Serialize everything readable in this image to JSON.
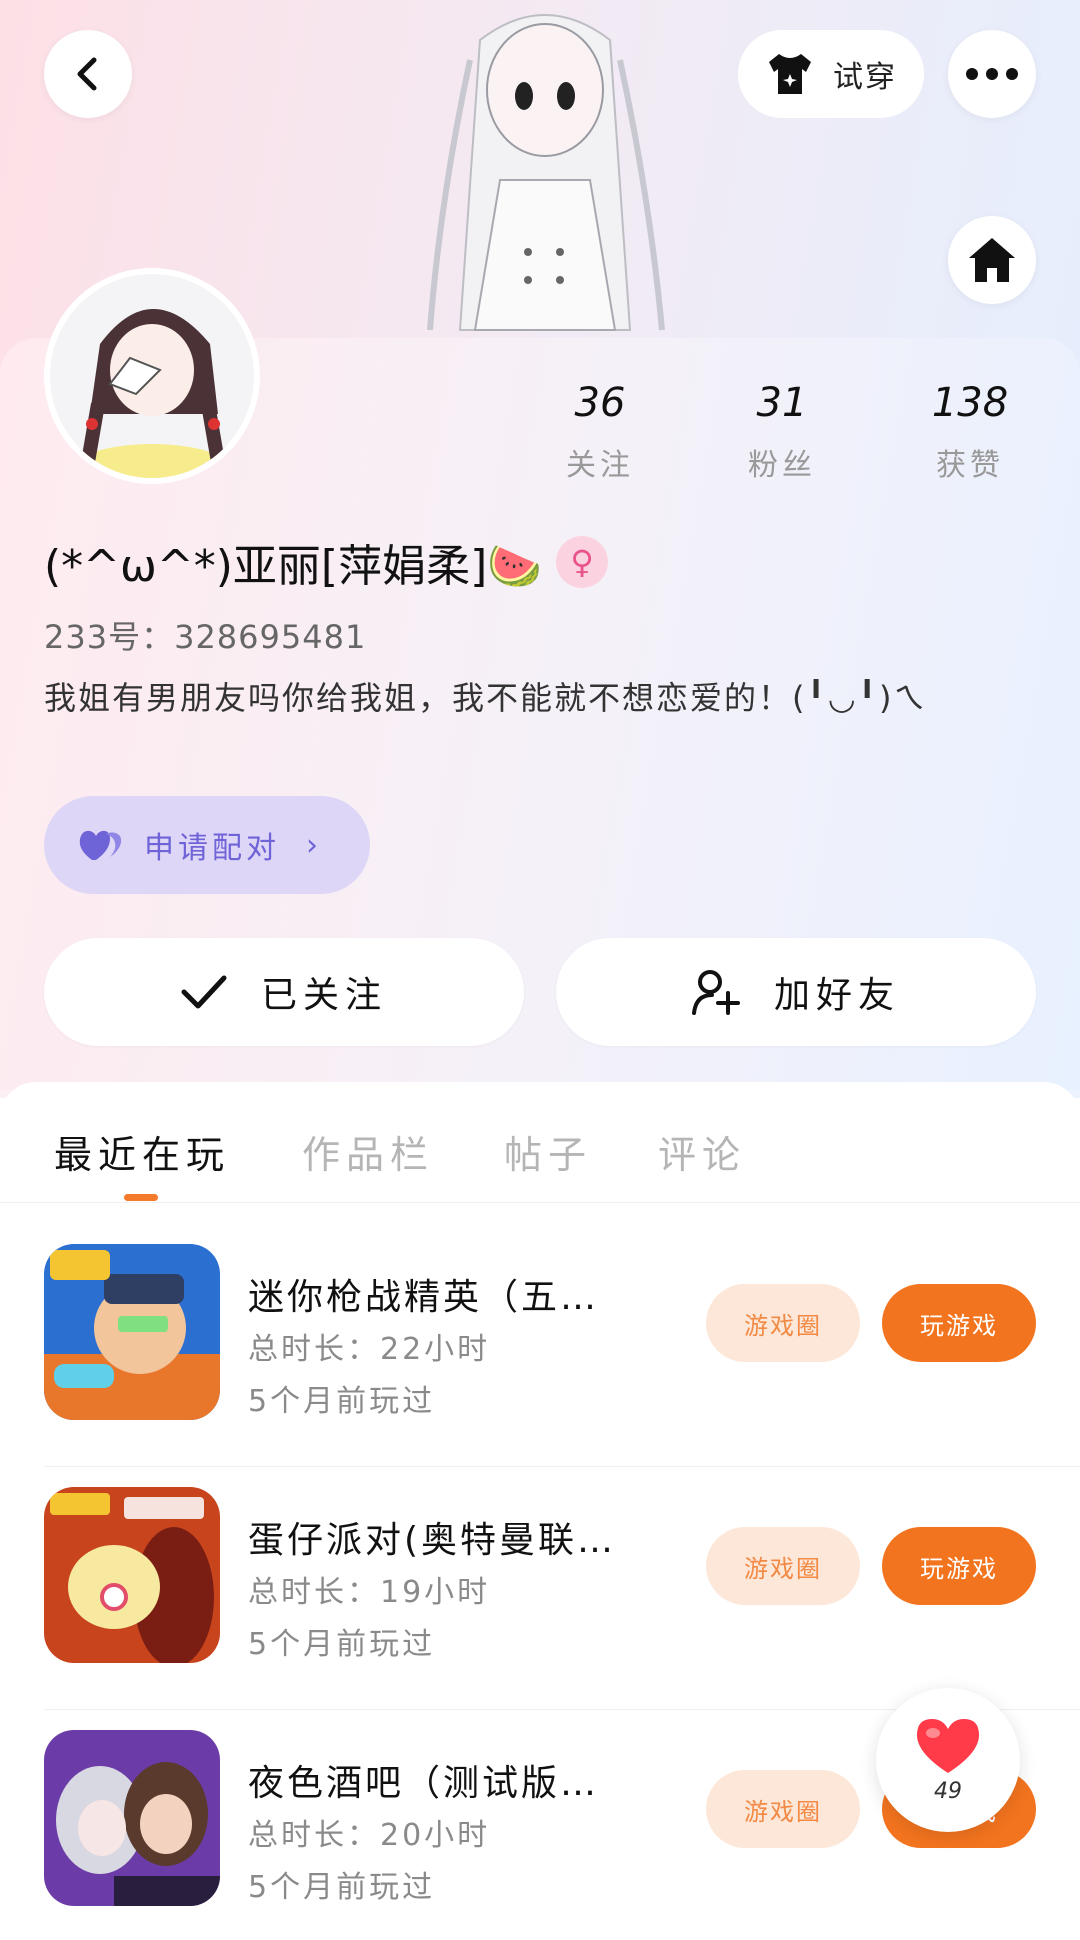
{
  "header": {
    "tryon_label": "试穿"
  },
  "profile": {
    "stats": [
      {
        "value": "36",
        "label": "关注"
      },
      {
        "value": "31",
        "label": "粉丝"
      },
      {
        "value": "138",
        "label": "获赞"
      }
    ],
    "nickname": "(*^ω^*)亚丽[萍娟柔]🍉",
    "gender_symbol": "♀",
    "uid": "233号：328695481",
    "bio": "我姐有男朋友吗你给我姐，我不能就不想恋爱的！(╹◡╹)ㄟ",
    "match_label": "申请配对",
    "followed_label": "已关注",
    "add_friend_label": "加好友"
  },
  "tabs": [
    "最近在玩",
    "作品栏",
    "帖子",
    "评论"
  ],
  "games": [
    {
      "title": "迷你枪战精英（五…",
      "playtime": "总时长：22小时",
      "last_played": "5个月前玩过",
      "circle_label": "游戏圈",
      "play_label": "玩游戏"
    },
    {
      "title": "蛋仔派对(奥特曼联…",
      "playtime": "总时长：19小时",
      "last_played": "5个月前玩过",
      "circle_label": "游戏圈",
      "play_label": "玩游戏"
    },
    {
      "title": "夜色酒吧（测试版…",
      "playtime": "总时长：20小时",
      "last_played": "5个月前玩过",
      "circle_label": "游戏圈",
      "play_label": "玩游戏"
    }
  ],
  "like_fab": {
    "count": "49"
  },
  "colors": {
    "accent_orange": "#f3741f",
    "circle_bg": "#fde7d8",
    "match_bg": "#ddd6f6",
    "match_text": "#6f63d8"
  }
}
